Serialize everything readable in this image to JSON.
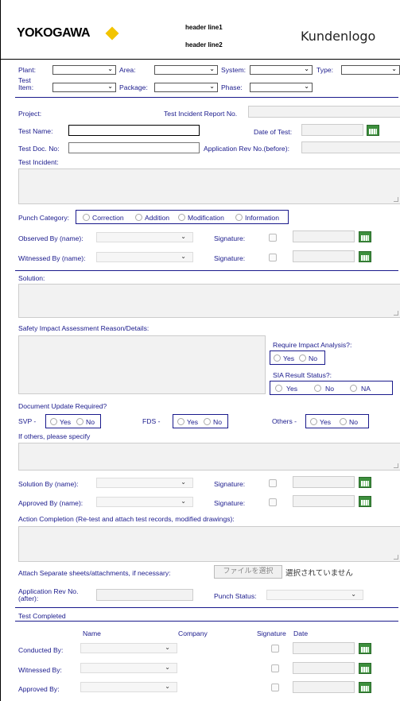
{
  "header": {
    "logo_text": "YOKOGAWA",
    "line1": "header line1",
    "line2": "header line2",
    "customer_logo": "Kundenlogo"
  },
  "filters": {
    "plant": "Plant:",
    "area": "Area:",
    "system": "System:",
    "type": "Type:",
    "test_item": "Test Item:",
    "package": "Package:",
    "phase": "Phase:"
  },
  "project": {
    "project": "Project:",
    "tir_no": "Test Incident Report No.",
    "test_name": "Test Name:",
    "date_of_test": "Date of Test:",
    "test_doc_no": "Test Doc. No:",
    "app_rev_before": "Application Rev No.(before):",
    "test_incident": "Test Incident:"
  },
  "punch": {
    "label": "Punch Category:",
    "options": [
      "Correction",
      "Addition",
      "Modification",
      "Information"
    ]
  },
  "observed": {
    "label": "Observed By (name):",
    "signature": "Signature:"
  },
  "witnessed": {
    "label": "Witnessed By (name):",
    "signature": "Signature:"
  },
  "solution": {
    "label": "Solution:"
  },
  "safety": {
    "label": "Safety Impact Assessment Reason/Details:",
    "require_label": "Require Impact Analysis?:",
    "require_opts": [
      "Yes",
      "No"
    ],
    "sia_label": "SIA Result Status?:",
    "sia_opts": [
      "Yes",
      "No",
      "NA"
    ]
  },
  "doc_update": {
    "label": "Document Update Required?",
    "svp": "SVP -",
    "fds": "FDS -",
    "others": "Others -",
    "yes": "Yes",
    "no": "No",
    "specify": "If others, please specify"
  },
  "solution_by": {
    "label": "Solution By (name):",
    "signature": "Signature:"
  },
  "approved_by": {
    "label": "Approved By (name):",
    "signature": "Signature:"
  },
  "action": {
    "label": "Action Completion (Re-test and attach test records, modified drawings):"
  },
  "attach": {
    "label": "Attach Separate sheets/attachments, if necessary:",
    "button": "ファイルを選択",
    "status": "選択されていません"
  },
  "after": {
    "app_rev": "Application Rev No. (after):",
    "punch_status": "Punch Status:"
  },
  "test_completed": {
    "title": "Test Completed",
    "col_name": "Name",
    "col_company": "Company",
    "col_signature": "Signature",
    "col_date": "Date",
    "conducted": "Conducted By:",
    "witnessed": "Witnessed By:",
    "approved": "Approved By:"
  },
  "colors": {
    "label": "#1a1a8c",
    "accent": "#f2c400",
    "calendar": "#3d8f3d"
  }
}
